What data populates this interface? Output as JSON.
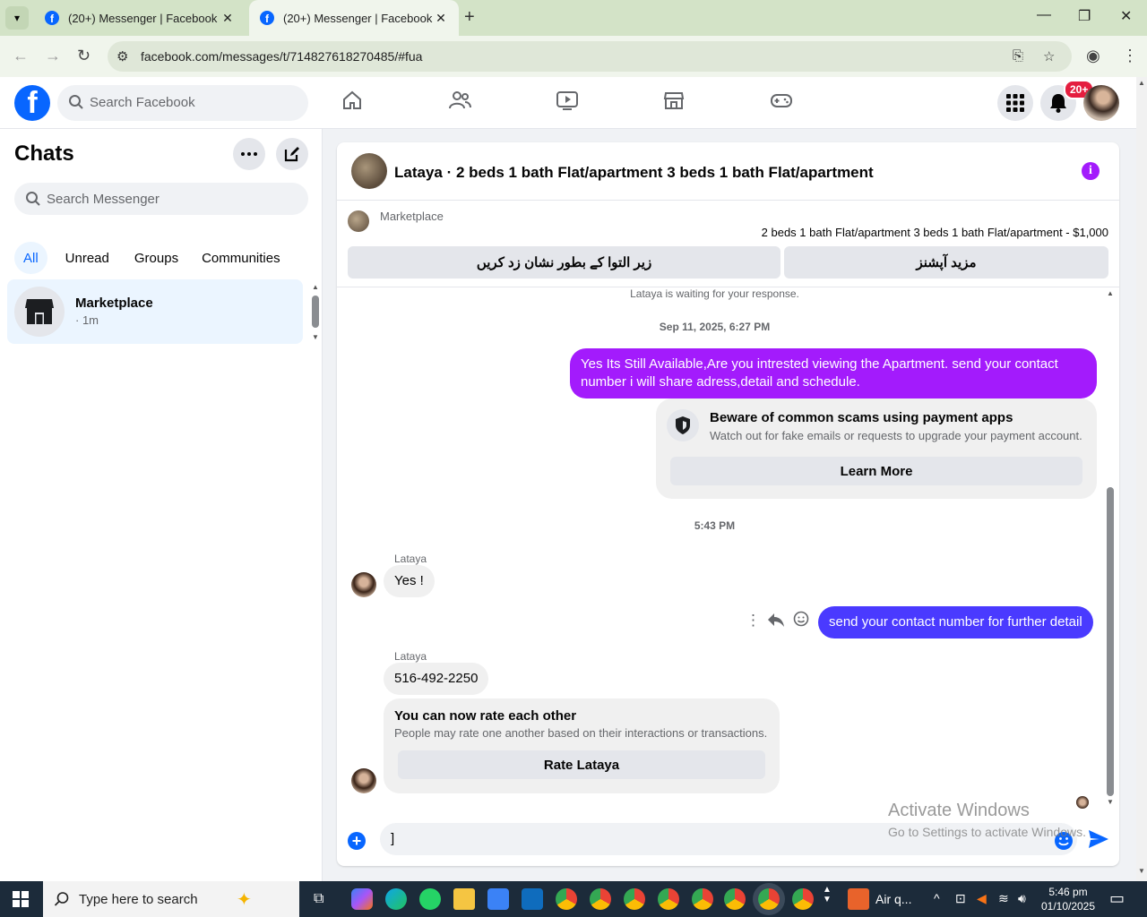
{
  "browser": {
    "tabs": [
      {
        "title": "(20+) Messenger | Facebook",
        "active": false
      },
      {
        "title": "(20+) Messenger | Facebook",
        "active": true
      }
    ],
    "new_tab": "+",
    "url": "facebook.com/messages/t/714827618270485/#fua",
    "window_controls": {
      "minimize": "—",
      "restore": "❐",
      "close": "✕"
    }
  },
  "facebook": {
    "logo": "f",
    "search_placeholder": "Search Facebook",
    "notification_badge": "20+"
  },
  "sidebar": {
    "title": "Chats",
    "search_placeholder": "Search Messenger",
    "filters": [
      "All",
      "Unread",
      "Groups",
      "Communities"
    ],
    "chats": [
      {
        "name": "Marketplace",
        "time": "· 1m"
      }
    ]
  },
  "conversation": {
    "title": "Lataya · 2 beds 1 bath Flat/apartment 3 beds 1 bath Flat/apartment",
    "marketplace_label": "Marketplace",
    "listing": "2 beds 1 bath Flat/apartment 3 beds 1 bath Flat/apartment - $1,000",
    "btn_mark_pending": "زیر التوا کے بطور نشان زد کریں",
    "btn_more_options": "مزید آپشنز",
    "waiting": "Lataya is waiting for your response.",
    "timestamp1": "Sep 11, 2025, 6:27 PM",
    "msg_out_1": "Yes Its Still Available,Are you intrested viewing the Apartment. send your contact number i will share adress,detail and schedule.",
    "scam_title": "Beware of common scams using payment apps",
    "scam_body": "Watch out for fake emails or requests to upgrade your payment account.",
    "scam_button": "Learn More",
    "timestamp2": "5:43 PM",
    "sender_name": "Lataya",
    "msg_in_1": "Yes !",
    "msg_out_2": "send your contact number for further detail",
    "msg_in_2": "516-492-2250",
    "rate_title": "You can now rate each other",
    "rate_body": "People may rate one another based on their interactions or transactions.",
    "rate_button": "Rate Lataya",
    "composer_value": "]"
  },
  "watermark": {
    "line1": "Activate Windows",
    "line2": "Go to Settings to activate Windows."
  },
  "taskbar": {
    "search_placeholder": "Type here to search",
    "weather": "Air q...",
    "time": "5:46 pm",
    "date": "01/10/2025"
  },
  "colors": {
    "accent_purple": "#a31bfc",
    "accent_blue_bubble": "#4a3aff",
    "facebook_blue": "#0866ff"
  }
}
